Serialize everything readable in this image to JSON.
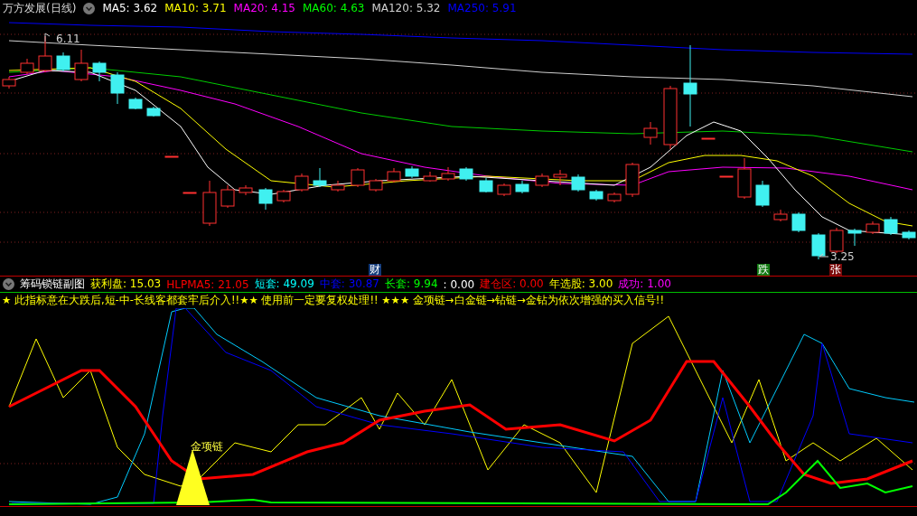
{
  "main_chart": {
    "title": "万方发展(日线)",
    "indicators": [
      {
        "label": "MA5: 3.62",
        "color": "#ffffff"
      },
      {
        "label": "MA10: 3.71",
        "color": "#ffff00"
      },
      {
        "label": "MA20: 4.15",
        "color": "#ff00ff"
      },
      {
        "label": "MA60: 4.63",
        "color": "#00ff00"
      },
      {
        "label": "MA120: 5.32",
        "color": "#d0d0d0"
      },
      {
        "label": "MA250: 5.91",
        "color": "#0000ff"
      }
    ],
    "high_label": "6.11",
    "low_label": "3.25",
    "event_badges": [
      {
        "text": "财",
        "color": "#123a7a"
      },
      {
        "text": "跌",
        "color": "#127a12"
      },
      {
        "text": "张",
        "color": "#7a0a0a"
      }
    ]
  },
  "sub_chart": {
    "title": "筹码锁链副图",
    "indicators": [
      {
        "label": "获利盘: 15.03",
        "color": "#ffff00"
      },
      {
        "label": "HLPMA5: 21.05",
        "color": "#ff0000"
      },
      {
        "label": "短套: 49.09",
        "color": "#00ffff"
      },
      {
        "label": "中套: 30.87",
        "color": "#0000ff"
      },
      {
        "label": "长套: 9.94",
        "color": "#00ff00"
      },
      {
        "label": ": 0.00",
        "color": "#ffffff"
      },
      {
        "label": "建仓区: 0.00",
        "color": "#ff0000"
      },
      {
        "label": "年选股: 3.00",
        "color": "#ffff00"
      },
      {
        "label": "成功: 1.00",
        "color": "#ff00ff"
      }
    ],
    "note": "★ 此指标意在大跌后,短-中-长线客都套牢后介入!!★★ 使用前一定要复权处理!! ★★★ 金项链→白金链→钻链→金钻为依次增强的买入信号!!",
    "signal_label": "金项链"
  }
}
